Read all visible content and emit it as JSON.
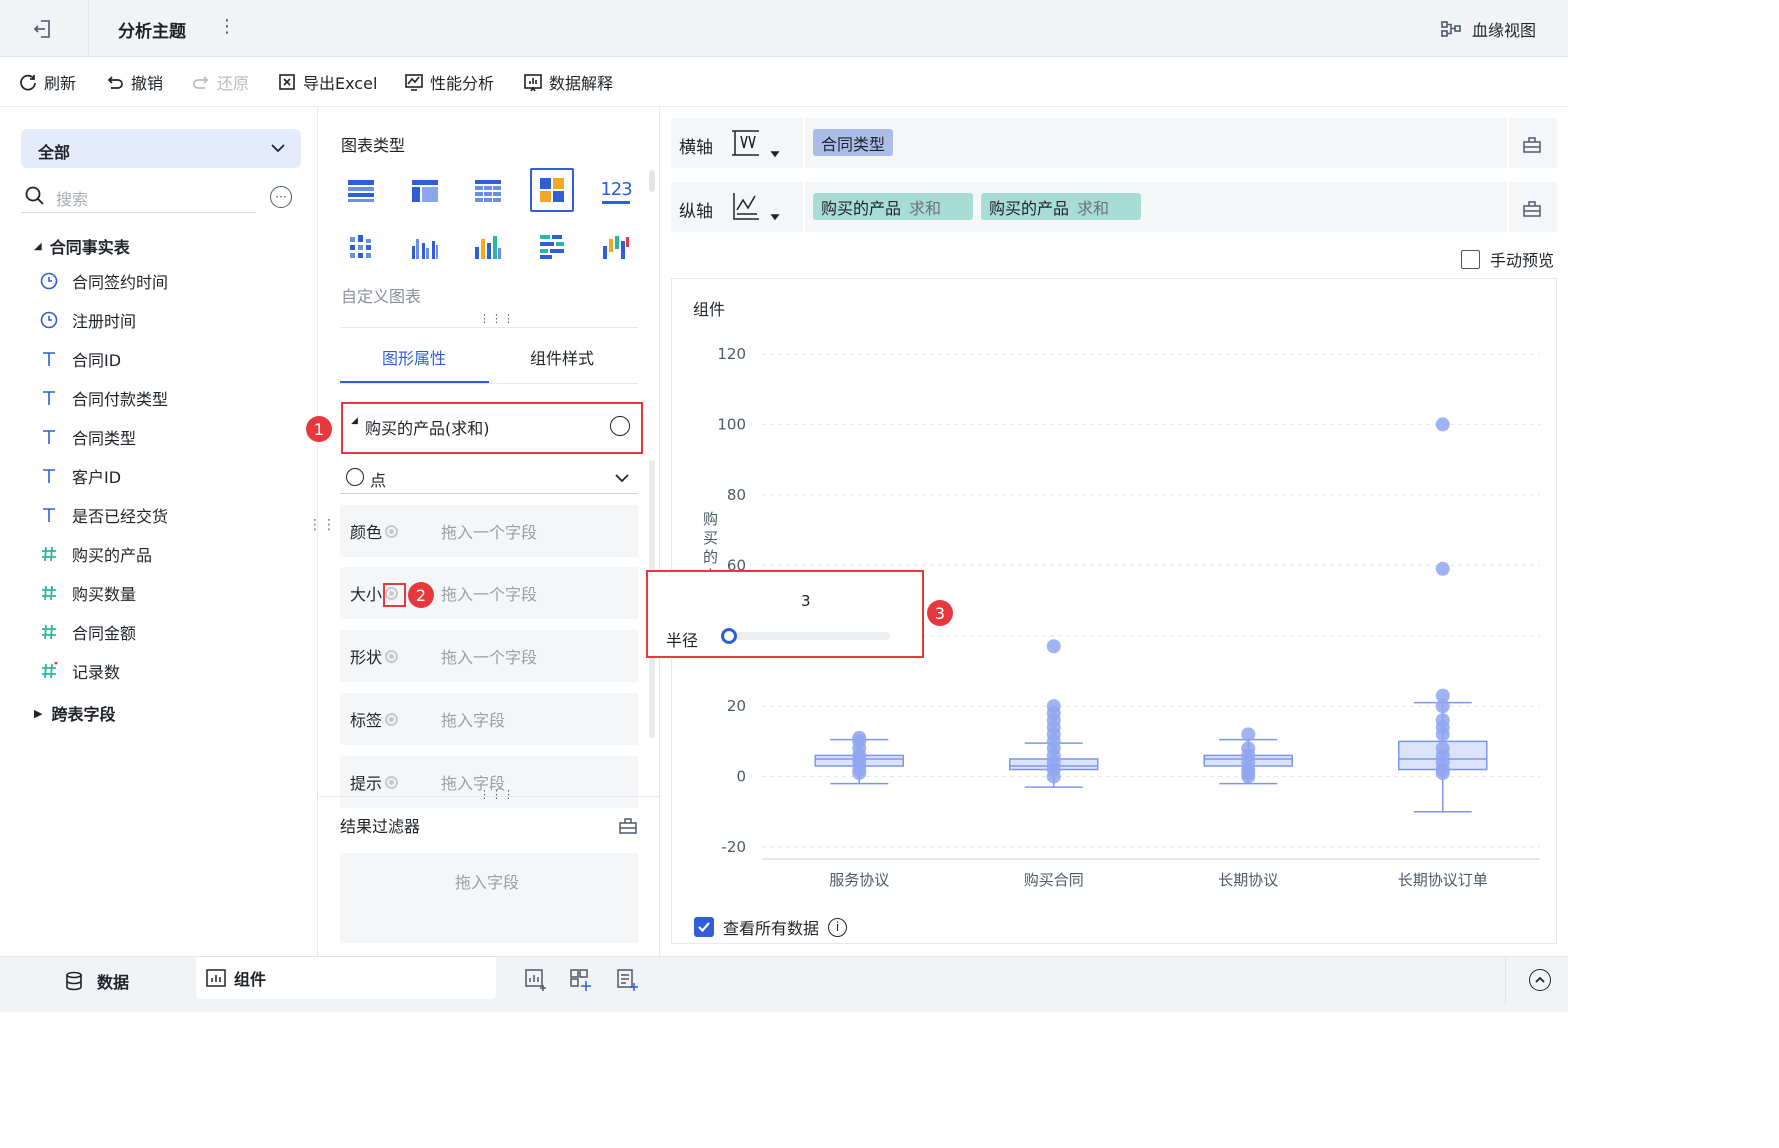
{
  "titlebar": {
    "title": "分析主题",
    "more": "⋮",
    "lineage_label": "血缘视图"
  },
  "toolbar": {
    "refresh": "刷新",
    "undo": "撤销",
    "redo": "还原",
    "export_excel": "导出Excel",
    "performance": "性能分析",
    "data_explain": "数据解释"
  },
  "left": {
    "scope_select": "全部",
    "search_placeholder": "搜索",
    "table_name": "合同事实表",
    "fields": [
      {
        "icon": "clock-icon",
        "label": "合同签约时间"
      },
      {
        "icon": "clock-icon",
        "label": "注册时间"
      },
      {
        "icon": "text-type-icon",
        "label": "合同ID"
      },
      {
        "icon": "text-type-icon",
        "label": "合同付款类型"
      },
      {
        "icon": "text-type-icon",
        "label": "合同类型"
      },
      {
        "icon": "text-type-icon",
        "label": "客户ID"
      },
      {
        "icon": "text-type-icon",
        "label": "是否已经交货"
      },
      {
        "icon": "number-type-icon",
        "label": "购买的产品"
      },
      {
        "icon": "number-type-icon",
        "label": "购买数量"
      },
      {
        "icon": "number-type-icon",
        "label": "合同金额"
      },
      {
        "icon": "count-type-icon",
        "label": "记录数"
      }
    ],
    "cross_table": "跨表字段"
  },
  "mid": {
    "chart_type_title": "图表类型",
    "custom_chart": "自定义图表",
    "number_chart_label": "123",
    "tabs": [
      "图形属性",
      "组件样式"
    ],
    "measure_header": "购买的产品(求和)",
    "mark_type": "点",
    "props": [
      {
        "label": "颜色",
        "placeholder": "拖入一个字段"
      },
      {
        "label": "大小",
        "placeholder": "拖入一个字段"
      },
      {
        "label": "形状",
        "placeholder": "拖入一个字段"
      },
      {
        "label": "标签",
        "placeholder": "拖入字段"
      },
      {
        "label": "提示",
        "placeholder": "拖入字段"
      }
    ],
    "filter_title": "结果过滤器",
    "filter_placeholder": "拖入字段"
  },
  "popup": {
    "value": "3",
    "label": "半径",
    "slider_value": 3
  },
  "badges": [
    "1",
    "2",
    "3"
  ],
  "right": {
    "x_axis_label": "横轴",
    "y_axis_label": "纵轴",
    "x_fields": [
      "合同类型"
    ],
    "y_fields": [
      {
        "name": "购买的产品",
        "agg": "求和"
      },
      {
        "name": "购买的产品",
        "agg": "求和"
      }
    ],
    "manual_preview": "手动预览",
    "view_all_data": "查看所有数据",
    "chart_title": "组件"
  },
  "bottom": {
    "data_tab": "数据",
    "component_tab": "组件"
  },
  "colors": {
    "accent": "#2f5ed8",
    "red": "#e8383d",
    "point": "#8fa6f0",
    "box_fill": "#dbe3fb",
    "box_stroke": "#7d96ec",
    "x_pill": "#a9bde8",
    "y_pill": "#a8ddd6"
  },
  "chart_data": {
    "type": "boxplot",
    "title": "组件",
    "ylabel": "购买的产品",
    "categories": [
      "服务协议",
      "购买合同",
      "长期协议",
      "长期协议订单"
    ],
    "yticks": [
      -20,
      0,
      20,
      40,
      60,
      80,
      100,
      120
    ],
    "ylim": [
      -20,
      120
    ],
    "boxes": [
      {
        "min": -2,
        "q1": 3,
        "median": 5,
        "q3": 6,
        "max": 10.5
      },
      {
        "min": -3,
        "q1": 2,
        "median": 3,
        "q3": 5,
        "max": 9.5
      },
      {
        "min": -2,
        "q1": 3,
        "median": 5,
        "q3": 6,
        "max": 10.5
      },
      {
        "min": -10,
        "q1": 2,
        "median": 5,
        "q3": 10,
        "max": 21
      }
    ],
    "points": [
      [
        11,
        10,
        8,
        6,
        5,
        4,
        2,
        1
      ],
      [
        37,
        20,
        18,
        16,
        14,
        12,
        10,
        8,
        6,
        4,
        2,
        0
      ],
      [
        12,
        8,
        6,
        4,
        2,
        1,
        0
      ],
      [
        100,
        59,
        23,
        20,
        16,
        14,
        12,
        8,
        6,
        4,
        2,
        1
      ]
    ],
    "grid": true
  }
}
